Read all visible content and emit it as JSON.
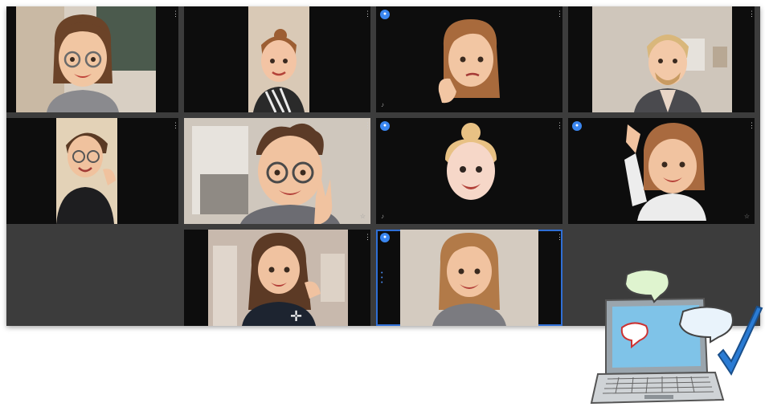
{
  "gallery": {
    "tiles": [
      {
        "id": "r1c1",
        "has_badge": false,
        "kebab": "⋮"
      },
      {
        "id": "r1c2",
        "has_badge": false,
        "kebab": "⋮"
      },
      {
        "id": "r1c3",
        "has_badge": true,
        "kebab": "⋮"
      },
      {
        "id": "r1c4",
        "has_badge": false,
        "kebab": "⋮"
      },
      {
        "id": "r2c1",
        "has_badge": false,
        "kebab": "⋮"
      },
      {
        "id": "r2c2",
        "has_badge": false,
        "kebab": "⋮"
      },
      {
        "id": "r2c3",
        "has_badge": true,
        "kebab": "⋮"
      },
      {
        "id": "r2c4",
        "has_badge": true,
        "kebab": "⋮"
      },
      {
        "id": "r3c2",
        "has_badge": false,
        "kebab": "⋮"
      },
      {
        "id": "r3c3",
        "has_badge": true,
        "kebab": "⋮",
        "active_speaker": true
      }
    ],
    "kebab_glyph": "⋮",
    "badge_glyph": "●",
    "mic_glyph": "♪",
    "pin_glyph": "☆",
    "dots_glyph": "•••"
  },
  "colors": {
    "grid_bg": "#3c3c3c",
    "tile_bg": "#0d0d0d",
    "active_outline": "#2f6fd6",
    "badge_blue": "#3a86f0",
    "check_blue": "#2a7bd4"
  },
  "illustration": {
    "icons": [
      "laptop-icon",
      "speech-bubble-icon",
      "checkmark-icon"
    ]
  }
}
